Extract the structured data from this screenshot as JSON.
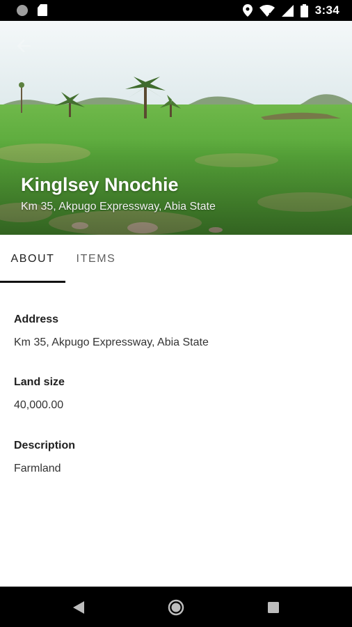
{
  "status_bar": {
    "time": "3:34",
    "icons": [
      "notification-dot-icon",
      "sd-card-icon",
      "location-icon",
      "wifi-icon",
      "cell-signal-icon",
      "battery-icon"
    ]
  },
  "hero": {
    "title": "Kinglsey Nnochie",
    "subtitle": "Km 35, Akpugo Expressway, Abia State",
    "back_icon": "arrow-back-icon"
  },
  "tabs": [
    {
      "label": "ABOUT",
      "selected": true
    },
    {
      "label": "ITEMS",
      "selected": false
    }
  ],
  "about": {
    "fields": [
      {
        "label": "Address",
        "value": "Km 35, Akpugo Expressway, Abia State"
      },
      {
        "label": "Land size",
        "value": "40,000.00"
      },
      {
        "label": "Description",
        "value": "Farmland"
      }
    ]
  },
  "nav_bar": {
    "buttons": [
      "back-triangle-icon",
      "home-circle-icon",
      "recents-square-icon"
    ]
  },
  "colors": {
    "status_bar": "#000000",
    "tab_indicator": "#111111",
    "grass": "#5aa83a",
    "sky": "#e8f1f4"
  }
}
